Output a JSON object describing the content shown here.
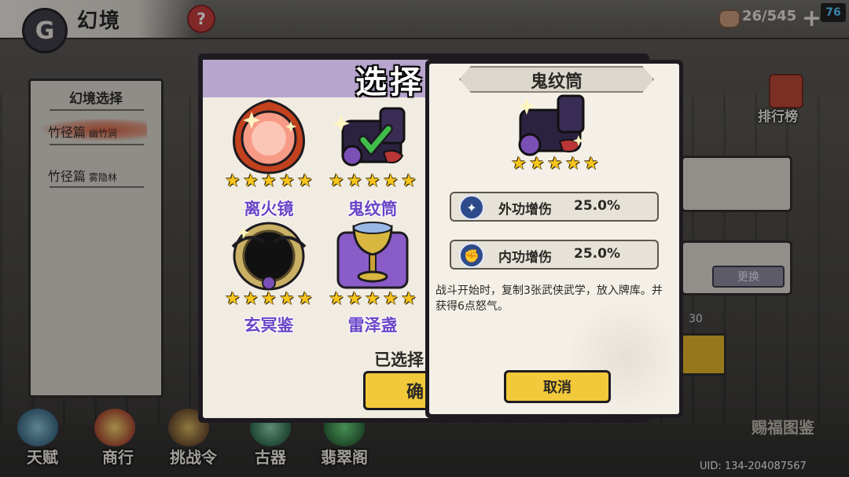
{
  "header": {
    "back_icon": "swirl-back-icon",
    "title": "幻境",
    "help_label": "?",
    "currency_icon": "bowl-icon",
    "currency_value": "26/545",
    "plus_label": "+",
    "badge": "76"
  },
  "left_panel": {
    "title": "幻境选择",
    "items": [
      {
        "label": "竹径篇",
        "sub": "幽竹涧"
      },
      {
        "label": "竹径篇",
        "sub": "雾隐林"
      }
    ]
  },
  "background": {
    "rank_label": "排行榜",
    "swap_label": "更换",
    "number": "30",
    "cuifu_label": "赐福图鉴"
  },
  "bottom_nav": [
    {
      "label": "天赋",
      "icon": "yin-yang-icon"
    },
    {
      "label": "商行",
      "icon": "shop-icon",
      "badge": "商"
    },
    {
      "label": "挑战令",
      "icon": "scroll-icon"
    },
    {
      "label": "古器",
      "icon": "artifact-icon"
    },
    {
      "label": "翡翠阁",
      "icon": "jade-icon"
    }
  ],
  "uid": "UID: 134-204087567",
  "select_modal": {
    "title": "选择",
    "items": [
      {
        "name": "离火镜",
        "stars": 5,
        "icon": "fire-mirror-icon",
        "selected": false
      },
      {
        "name": "鬼纹筒",
        "stars": 5,
        "icon": "ghost-cannon-icon",
        "selected": true
      },
      {
        "name": "玄冥鉴",
        "stars": 5,
        "icon": "dark-mirror-icon",
        "selected": false
      },
      {
        "name": "雷泽盏",
        "stars": 5,
        "icon": "thunder-cup-icon",
        "selected": false
      }
    ],
    "selected_label": "已选择",
    "confirm_label": "确"
  },
  "detail_popup": {
    "title": "鬼纹筒",
    "stars": 5,
    "art_icon": "ghost-cannon-icon",
    "stats": [
      {
        "icon": "outer-attack-icon",
        "label": "外功增伤",
        "value": "25.0%"
      },
      {
        "icon": "inner-attack-icon",
        "label": "内功增伤",
        "value": "25.0%"
      }
    ],
    "description": "战斗开始时，复制3张武侠武学，放入牌库。并获得6点怒气。",
    "cancel_label": "取消"
  },
  "colors": {
    "accent_yellow": "#f2c93a",
    "item_name_purple": "#6b45c7",
    "star_gold": "#f7c51c",
    "modal_header_lilac": "#b9a6cf"
  }
}
